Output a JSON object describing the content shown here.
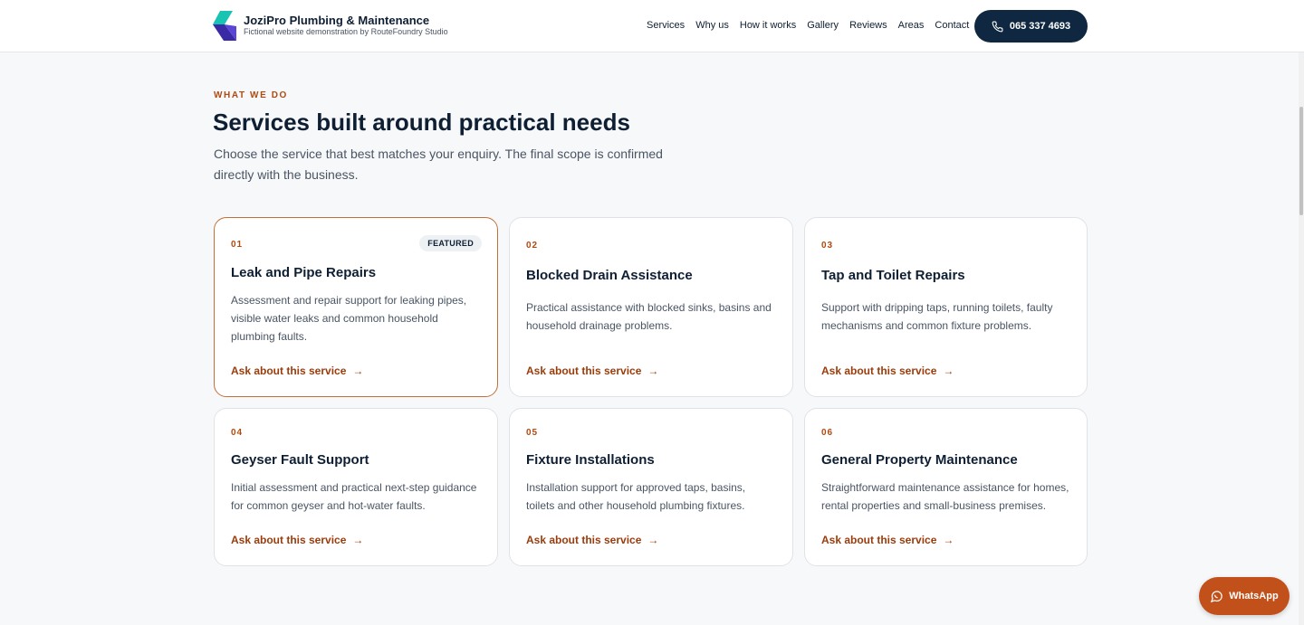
{
  "header": {
    "brand_title": "JoziPro Plumbing & Maintenance",
    "brand_subtitle": "Fictional website demonstration by RouteFoundry Studio",
    "nav": [
      "Services",
      "Why us",
      "How it works",
      "Gallery",
      "Reviews",
      "Areas",
      "Contact"
    ],
    "phone": "065 337 4693"
  },
  "section": {
    "eyebrow": "WHAT WE DO",
    "title": "Services built around practical needs",
    "intro": "Choose the service that best matches your enquiry. The final scope is confirmed directly with the business."
  },
  "cards": [
    {
      "num": "01",
      "title": "Leak and Pipe Repairs",
      "desc": "Assessment and repair support for leaking pipes, visible water leaks and common household plumbing faults.",
      "link": "Ask about this service",
      "badge": "FEATURED"
    },
    {
      "num": "02",
      "title": "Blocked Drain Assistance",
      "desc": "Practical assistance with blocked sinks, basins and household drainage problems.",
      "link": "Ask about this service"
    },
    {
      "num": "03",
      "title": "Tap and Toilet Repairs",
      "desc": "Support with dripping taps, running toilets, faulty mechanisms and common fixture problems.",
      "link": "Ask about this service"
    },
    {
      "num": "04",
      "title": "Geyser Fault Support",
      "desc": "Initial assessment and practical next-step guidance for common geyser and hot-water faults.",
      "link": "Ask about this service"
    },
    {
      "num": "05",
      "title": "Fixture Installations",
      "desc": "Installation support for approved taps, basins, toilets and other household plumbing fixtures.",
      "link": "Ask about this service"
    },
    {
      "num": "06",
      "title": "General Property Maintenance",
      "desc": "Straightforward maintenance assistance for homes, rental properties and small-business premises.",
      "link": "Ask about this service"
    }
  ],
  "whatsapp": {
    "label": "WhatsApp"
  },
  "icons": {
    "phone": "phone-icon",
    "whatsapp": "chat-bubble-icon",
    "arrow": "arrow-right-icon",
    "logo": "brand-logo-icon"
  },
  "colors": {
    "accent": "#b04a10",
    "navy": "#0f2740",
    "whatsapp": "#c2501a"
  }
}
